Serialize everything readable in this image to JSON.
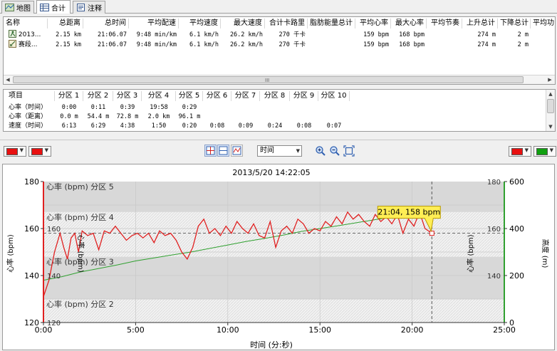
{
  "tabs": [
    {
      "label": "地图",
      "icon": "map-icon",
      "active": false
    },
    {
      "label": "合计",
      "icon": "table-icon",
      "active": true
    },
    {
      "label": "注释",
      "icon": "note-icon",
      "active": false
    }
  ],
  "summary": {
    "columns": [
      "名称",
      "总距离",
      "总时间",
      "平均配速",
      "平均速度",
      "最大速度",
      "合计卡路里",
      "脂肪能量总计",
      "平均心率",
      "最大心率",
      "平均节奏",
      "上升总计",
      "下降总计",
      "平均功"
    ],
    "rows": [
      {
        "icon": "activity-icon",
        "cells": [
          "2013...",
          "2.15 km",
          "21:06.07",
          "9:48 min/km",
          "6.1 km/h",
          "26.2 km/h",
          "270 千卡",
          "",
          "159 bpm",
          "168 bpm",
          "",
          "274 m",
          "2 m",
          ""
        ]
      },
      {
        "icon": "lap-icon",
        "cells": [
          "赛段...",
          "2.15 km",
          "21:06.07",
          "9:48 min/km",
          "6.1 km/h",
          "26.2 km/h",
          "270 千卡",
          "",
          "159 bpm",
          "168 bpm",
          "",
          "274 m",
          "2 m",
          ""
        ]
      }
    ],
    "scroll_grip": "III"
  },
  "zones": {
    "columns": [
      "项目",
      "分区 1",
      "分区 2",
      "分区 3",
      "分区 4",
      "分区 5",
      "分区 6",
      "分区 7",
      "分区 8",
      "分区 9",
      "分区 10"
    ],
    "rows": [
      [
        "心率（时间）",
        "0:00",
        "0:11",
        "0:39",
        "19:58",
        "0:29",
        "",
        "",
        "",
        "",
        ""
      ],
      [
        "心率（距离）",
        "0.0 m",
        "54.4 m",
        "72.8 m",
        "2.0 km",
        "96.1 m",
        "",
        "",
        "",
        "",
        ""
      ],
      [
        "速度（时间）",
        "6:13",
        "6:29",
        "4:38",
        "1:50",
        "0:20",
        "0:08",
        "0:09",
        "0:24",
        "0:08",
        "0:07"
      ]
    ]
  },
  "toolbar": {
    "left_colors": [
      "#e81010",
      "#e81010"
    ],
    "right_colors": [
      "#e81010",
      "#10a010"
    ],
    "x_mode_select": "时间",
    "tools": [
      "crosshair-icon",
      "split-view-icon",
      "line-graph-icon"
    ],
    "zoom_tools": [
      "zoom-in-icon",
      "zoom-out-icon",
      "fit-icon"
    ]
  },
  "chart_data": {
    "type": "line",
    "title": "2013/5/20 14:22:05",
    "xlabel": "时间 (分:秒)",
    "ylabel_left": "心率 (bpm)",
    "ylabel_right_inner": "心率 (bpm)",
    "ylabel_right_outer": "高度 (m)",
    "ylabel_left_inner": "心率 (bpm)",
    "xlim": [
      0,
      25
    ],
    "x_ticks": [
      "0:00",
      "5:00",
      "10:00",
      "15:00",
      "20:00",
      "25:00"
    ],
    "x_tick_values": [
      0,
      5,
      10,
      15,
      20,
      25
    ],
    "ylim_left": [
      120,
      180
    ],
    "y_ticks_left": [
      "120",
      "140",
      "160",
      "180"
    ],
    "y_ticks_left_inner": [
      "120",
      "140",
      "160"
    ],
    "ylim_right_outer": [
      0,
      600
    ],
    "y_ticks_right_outer": [
      "0",
      "200",
      "400",
      "600"
    ],
    "y_ticks_right_inner": [
      "140",
      "160",
      "180"
    ],
    "zones": [
      {
        "label": "心率 (bpm) 分区 5",
        "from": 167,
        "to": 180,
        "shade": "solid"
      },
      {
        "label": "心率 (bpm) 分区 4",
        "from": 148,
        "to": 167,
        "shade": "hatch"
      },
      {
        "label": "心率 (bpm) 分区 3",
        "from": 130,
        "to": 148,
        "shade": "solid"
      },
      {
        "label": "心率 (bpm) 分区 2",
        "from": 120,
        "to": 130,
        "shade": "hatch"
      }
    ],
    "average_hr": 158,
    "cursor": {
      "x": 21.07,
      "y": 158,
      "label": "21:04, 158 bpm"
    },
    "series": [
      {
        "name": "心率 (bpm)",
        "color": "#e02020",
        "axis": "left",
        "x": [
          0,
          0.3,
          0.6,
          0.9,
          1.1,
          1.3,
          1.5,
          1.7,
          1.9,
          2.1,
          2.4,
          2.7,
          3.0,
          3.3,
          3.6,
          3.9,
          4.2,
          4.5,
          4.8,
          5.1,
          5.4,
          5.7,
          6.0,
          6.3,
          6.6,
          6.9,
          7.2,
          7.5,
          7.8,
          8.1,
          8.4,
          8.7,
          9.0,
          9.3,
          9.6,
          9.9,
          10.2,
          10.5,
          10.8,
          11.1,
          11.4,
          11.7,
          12.0,
          12.3,
          12.6,
          12.9,
          13.2,
          13.5,
          13.8,
          14.1,
          14.4,
          14.7,
          15.0,
          15.3,
          15.6,
          15.9,
          16.2,
          16.5,
          16.8,
          17.1,
          17.4,
          17.7,
          18.0,
          18.3,
          18.6,
          18.9,
          19.2,
          19.5,
          19.8,
          20.1,
          20.4,
          20.7,
          21.07
        ],
        "y": [
          131,
          138,
          150,
          158,
          152,
          147,
          156,
          158,
          150,
          159,
          157,
          158,
          151,
          159,
          158,
          161,
          158,
          155,
          157,
          158,
          156,
          158,
          154,
          159,
          157,
          158,
          155,
          150,
          147,
          152,
          161,
          164,
          158,
          160,
          157,
          161,
          158,
          163,
          160,
          158,
          162,
          157,
          156,
          163,
          152,
          159,
          161,
          158,
          164,
          162,
          158,
          160,
          159,
          163,
          161,
          165,
          162,
          167,
          164,
          166,
          163,
          161,
          166,
          163,
          165,
          162,
          166,
          158,
          164,
          161,
          167,
          160,
          158
        ]
      },
      {
        "name": "高度 (m)",
        "color": "#30a030",
        "axis": "right",
        "x": [
          0,
          1,
          2,
          3,
          4,
          5,
          6,
          7,
          8,
          9,
          10,
          11,
          12,
          13,
          14,
          15,
          16,
          17,
          18,
          19,
          20,
          21.07
        ],
        "y": [
          180,
          195,
          215,
          230,
          245,
          262,
          275,
          288,
          300,
          315,
          330,
          345,
          358,
          372,
          388,
          400,
          412,
          425,
          438,
          450,
          462,
          470
        ]
      }
    ],
    "grid": true
  }
}
